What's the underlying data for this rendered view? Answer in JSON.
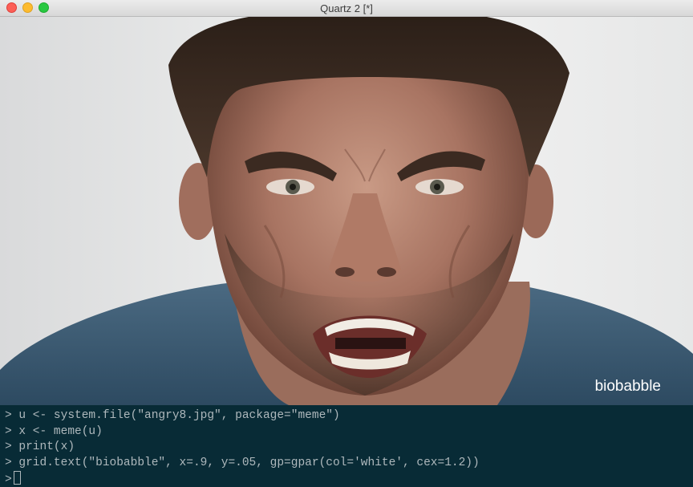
{
  "window": {
    "title": "Quartz 2 [*]"
  },
  "plot": {
    "image_subject": "angry man face photo",
    "caption": "biobabble",
    "caption_color": "#ffffff"
  },
  "console": {
    "prompt": ">",
    "lines": [
      "u <- system.file(\"angry8.jpg\", package=\"meme\")",
      "x <- meme(u)",
      "print(x)",
      "grid.text(\"biobabble\", x=.9, y=.05, gp=gpar(col='white', cex=1.2))"
    ],
    "background": "#082b36"
  }
}
